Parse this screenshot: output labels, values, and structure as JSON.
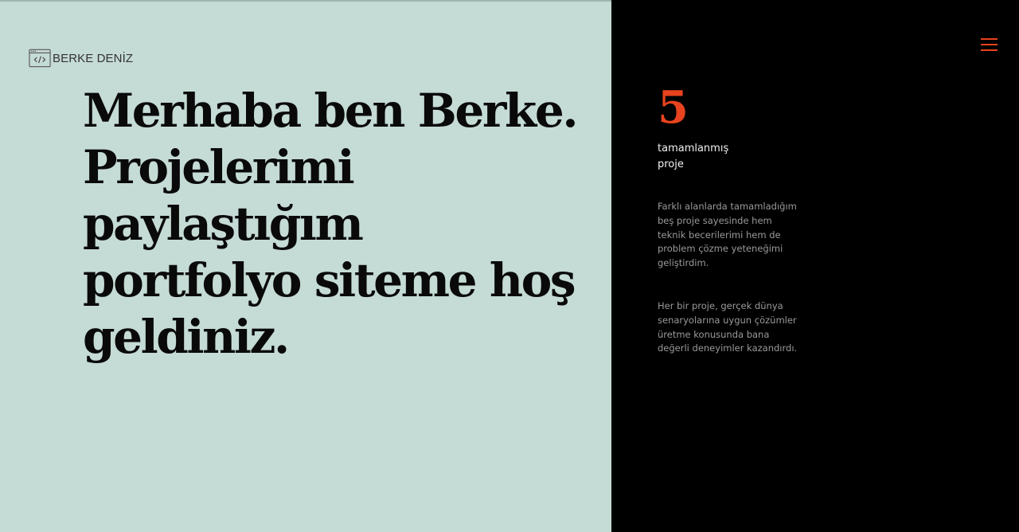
{
  "brand": {
    "name": "BERKE DENİZ",
    "icon": "code-window-icon"
  },
  "hero": {
    "heading": "Merhaba ben Berke. Projelerimi paylaştığım portfolyo siteme hoş geldiniz."
  },
  "menu": {
    "icon": "hamburger-menu-icon",
    "color": "#e8431e"
  },
  "stats": {
    "number": "5",
    "label": "tamamlanmış\nproje"
  },
  "description": {
    "paragraph1": "Farklı alanlarda tamamladığım beş proje sayesinde hem teknik becerilerimi hem de problem çözme yeteneğimi geliştirdim.",
    "paragraph2": "Her bir proje, gerçek dünya senaryolarına uygun çözümler üretme konusunda bana değerli deneyimler kazandırdı."
  },
  "colors": {
    "left_panel": "#c5dbd5",
    "right_panel": "#000000",
    "accent": "#e8431e"
  }
}
